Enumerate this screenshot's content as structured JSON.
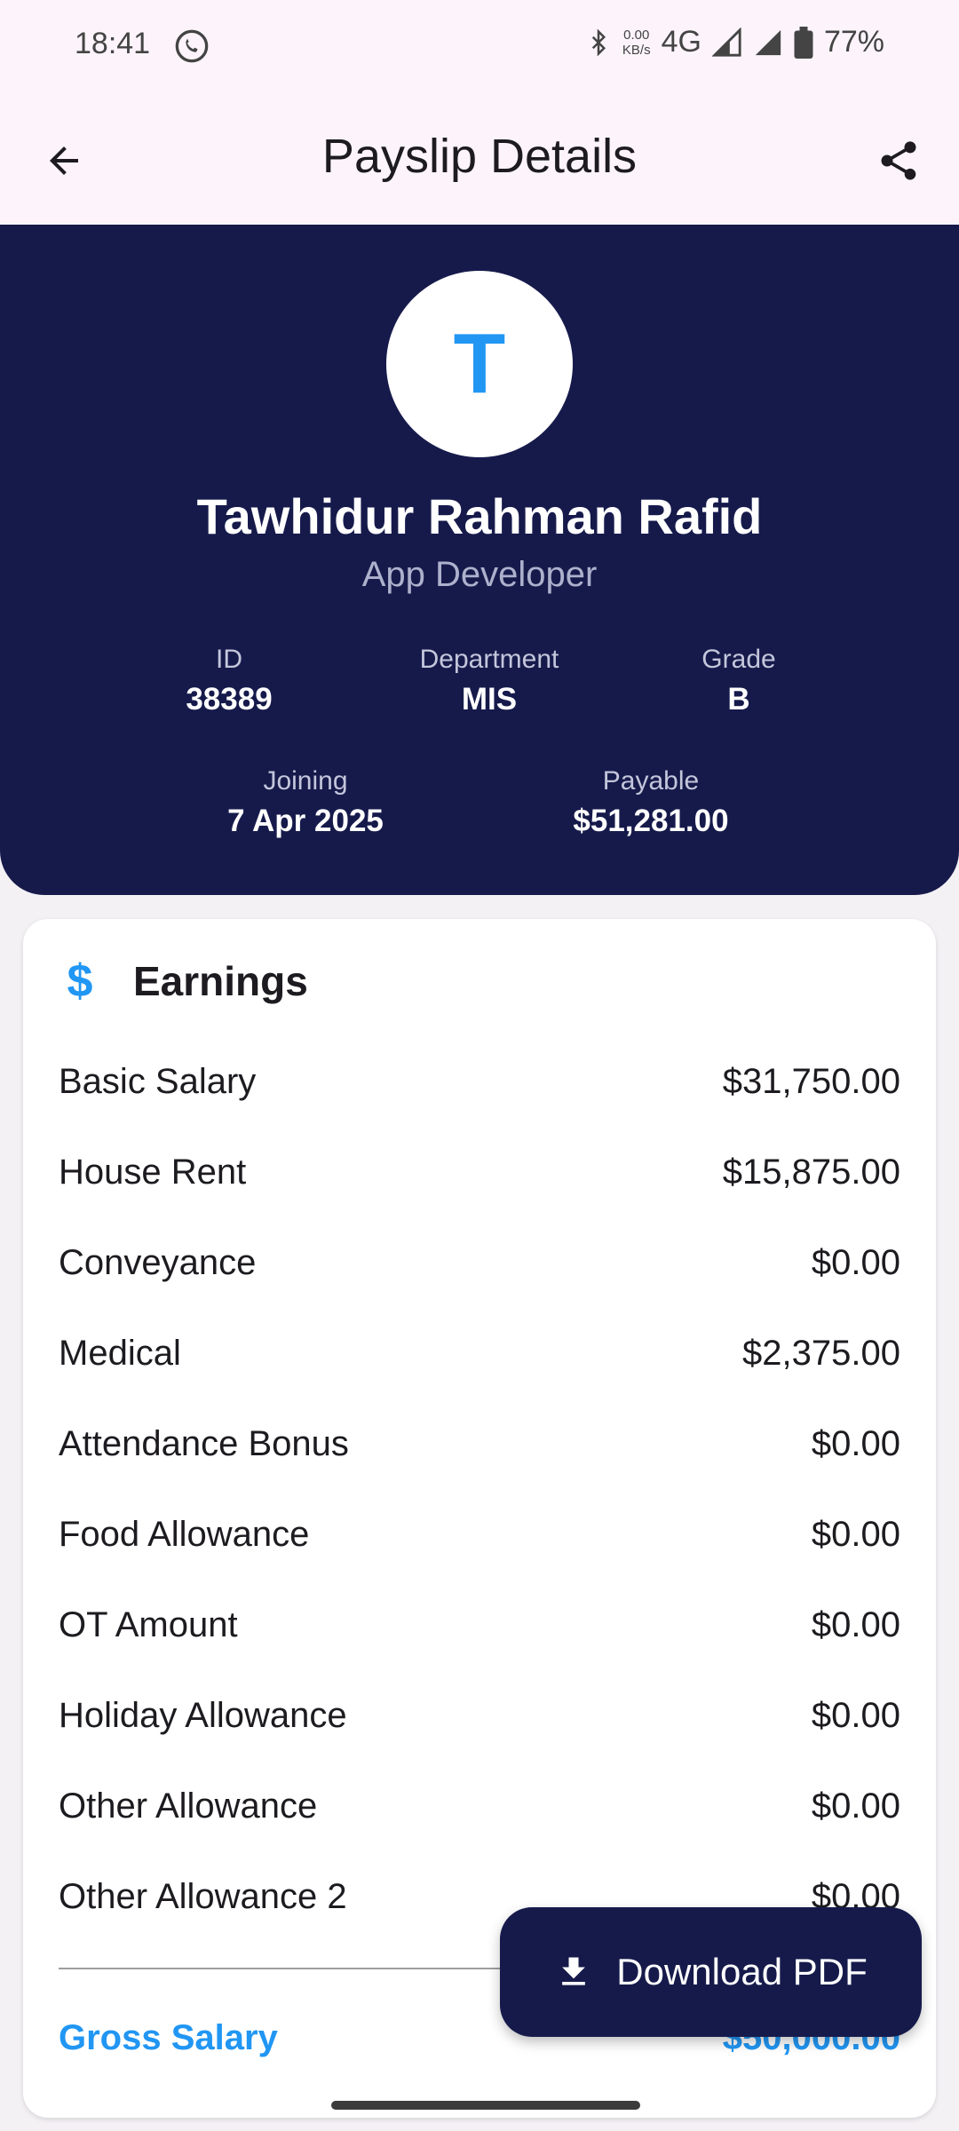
{
  "status_bar": {
    "time": "18:41",
    "net_speed_value": "0.00",
    "net_speed_unit": "KB/s",
    "network": "4G",
    "battery": "77%"
  },
  "app_bar": {
    "title": "Payslip Details",
    "back_icon": "arrow-back-icon",
    "share_icon": "share-icon"
  },
  "employee": {
    "avatar_initial": "T",
    "name": "Tawhidur Rahman Rafid",
    "role": "App Developer",
    "id_label": "ID",
    "id_value": "38389",
    "department_label": "Department",
    "department_value": "MIS",
    "grade_label": "Grade",
    "grade_value": "B",
    "joining_label": "Joining",
    "joining_value": "7 Apr 2025",
    "payable_label": "Payable",
    "payable_value": "$51,281.00"
  },
  "earnings": {
    "icon": "dollar-icon",
    "title": "Earnings",
    "items": [
      {
        "label": "Basic Salary",
        "value": "$31,750.00"
      },
      {
        "label": "House Rent",
        "value": "$15,875.00"
      },
      {
        "label": "Conveyance",
        "value": "$0.00"
      },
      {
        "label": "Medical",
        "value": "$2,375.00"
      },
      {
        "label": "Attendance Bonus",
        "value": "$0.00"
      },
      {
        "label": "Food Allowance",
        "value": "$0.00"
      },
      {
        "label": "OT Amount",
        "value": "$0.00"
      },
      {
        "label": "Holiday Allowance",
        "value": "$0.00"
      },
      {
        "label": "Other Allowance",
        "value": "$0.00"
      },
      {
        "label": "Other Allowance 2",
        "value": "$0.00"
      }
    ],
    "gross_label": "Gross Salary",
    "gross_value": "$50,000.00"
  },
  "fab": {
    "label": "Download PDF",
    "icon": "download-icon"
  },
  "colors": {
    "header_bg": "#161a4b",
    "accent": "#2196f3",
    "app_bar_bg": "#fcf4fa"
  }
}
